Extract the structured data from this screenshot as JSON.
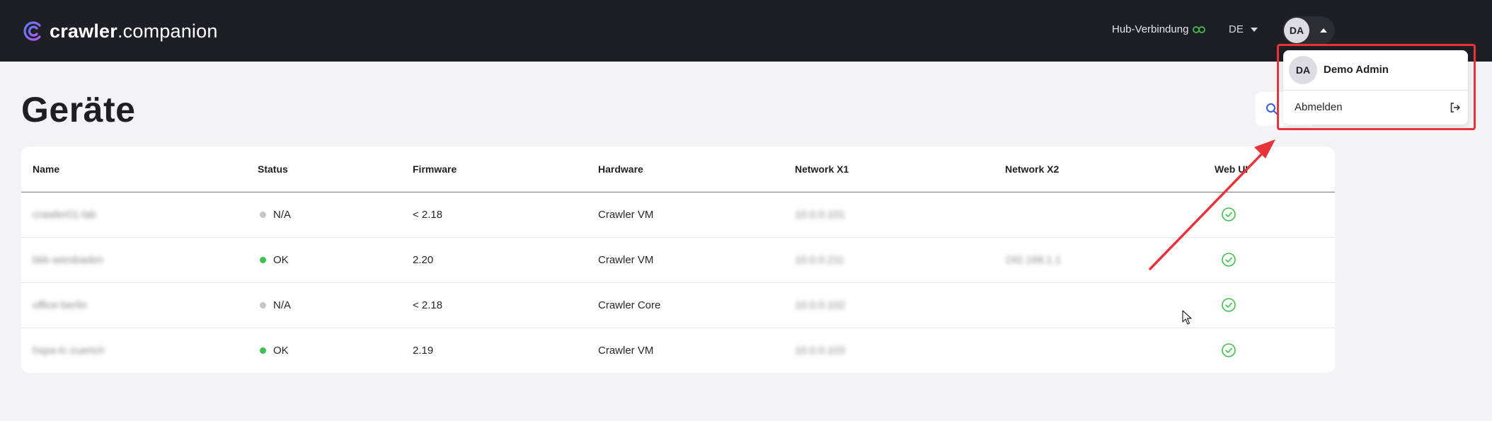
{
  "app": {
    "brand_bold": "crawler",
    "brand_light": ".companion"
  },
  "header": {
    "hub_label": "Hub-Verbindung",
    "language": "DE",
    "user_initials": "DA"
  },
  "page": {
    "title": "Geräte"
  },
  "table": {
    "columns": [
      "Name",
      "Status",
      "Firmware",
      "Hardware",
      "Network X1",
      "Network X2",
      "Web UI"
    ],
    "rows": [
      {
        "name": "crawler01-lab",
        "status": "N/A",
        "firmware": "< 2.18",
        "hardware": "Crawler VM",
        "x1": "10.0.0.101",
        "x2": "",
        "web_ui": true
      },
      {
        "name": "bkk-wiesbaden",
        "status": "OK",
        "firmware": "2.20",
        "hardware": "Crawler VM",
        "x1": "10.0.0.211",
        "x2": "192.168.1.1",
        "web_ui": true
      },
      {
        "name": "office-berlin",
        "status": "N/A",
        "firmware": "< 2.18",
        "hardware": "Crawler Core",
        "x1": "10.0.0.102",
        "x2": "",
        "web_ui": true
      },
      {
        "name": "hspa-lc-zuerich",
        "status": "OK",
        "firmware": "2.19",
        "hardware": "Crawler VM",
        "x1": "10.0.0.103",
        "x2": "",
        "web_ui": true
      }
    ]
  },
  "user_menu": {
    "initials": "DA",
    "name": "Demo Admin",
    "logout_label": "Abmelden"
  },
  "colors": {
    "header_bg": "#1e1f24",
    "accent_purple": "#8b5cf6",
    "status_ok": "#3fbf4d",
    "status_na": "#c5c5ca",
    "annotation_red": "#e8333a"
  }
}
